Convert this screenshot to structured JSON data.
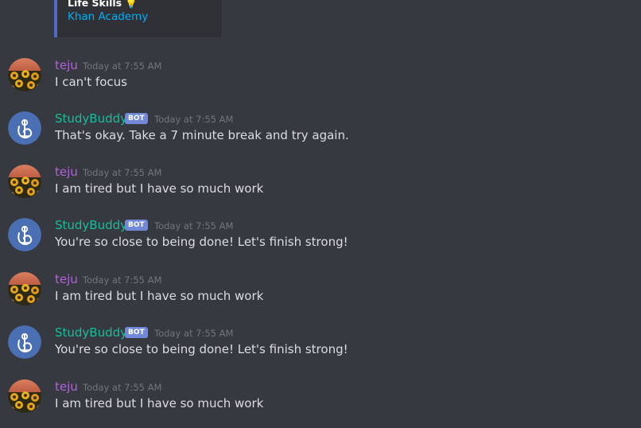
{
  "embed": {
    "title": "Life Skills",
    "title_icon": "lightbulb",
    "link": "Khan Academy"
  },
  "bot_tag": "BOT",
  "messages": [
    {
      "author": "teju",
      "timestamp": "Today at 7:55 AM",
      "content": "I can't focus"
    },
    {
      "author": "StudyBuddy",
      "timestamp": "Today at 7:55 AM",
      "content": "That's okay. Take a 7 minute break and try again."
    },
    {
      "author": "teju",
      "timestamp": "Today at 7:55 AM",
      "content": "I am tired but I have so much work"
    },
    {
      "author": "StudyBuddy",
      "timestamp": "Today at 7:55 AM",
      "content": "You're so close to being done! Let's finish strong!"
    },
    {
      "author": "teju",
      "timestamp": "Today at 7:55 AM",
      "content": "I am tired but I have so much work"
    },
    {
      "author": "StudyBuddy",
      "timestamp": "Today at 7:55 AM",
      "content": "You're so close to being done! Let's finish strong!"
    },
    {
      "author": "teju",
      "timestamp": "Today at 7:55 AM",
      "content": "I am tired but I have so much work"
    }
  ],
  "colors": {
    "background": "#36393f",
    "user_name": "#b065d6",
    "bot_name": "#1abc9c",
    "bot_tag": "#7289da",
    "link": "#00aff4",
    "timestamp": "#72767d",
    "message_text": "#dcddde"
  }
}
